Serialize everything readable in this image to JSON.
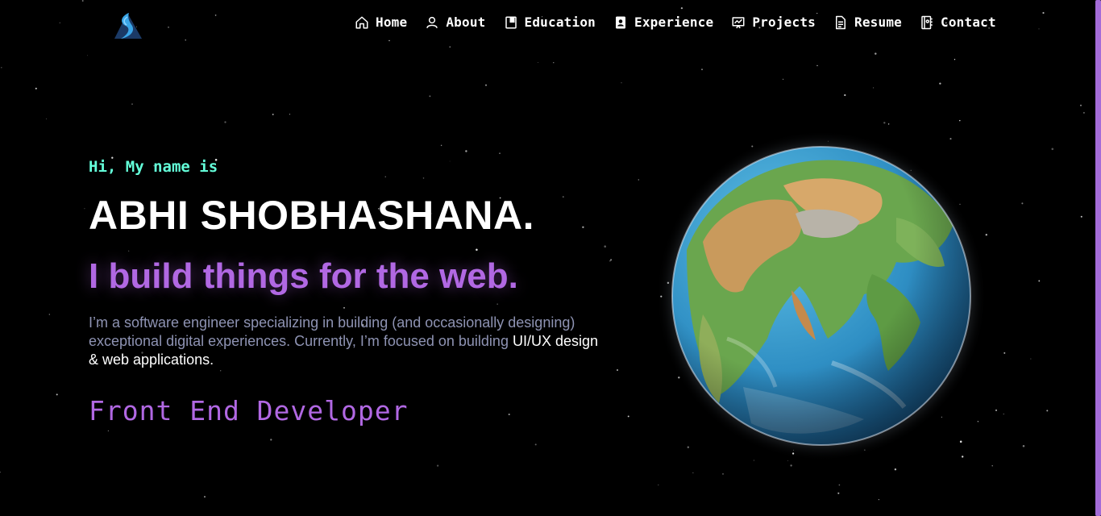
{
  "nav": {
    "items": [
      {
        "label": "Home",
        "icon": "home-icon"
      },
      {
        "label": "About",
        "icon": "user-icon"
      },
      {
        "label": "Education",
        "icon": "book-icon"
      },
      {
        "label": "Experience",
        "icon": "badge-icon"
      },
      {
        "label": "Projects",
        "icon": "presentation-icon"
      },
      {
        "label": "Resume",
        "icon": "document-icon"
      },
      {
        "label": "Contact",
        "icon": "contact-book-icon"
      }
    ]
  },
  "hero": {
    "greeting": "Hi, My name is",
    "name": "ABHI SHOBHASHANA.",
    "tagline": "I build things for the web.",
    "bio_text": "I’m a software engineer specializing in building (and occasionally designing) exceptional digital experiences. Currently, I’m focused on building ",
    "bio_highlight": "UI/UX design & web applications.",
    "role": "Front End Developer"
  },
  "colors": {
    "background": "#000000",
    "greeting": "#64ffda",
    "accent": "#b168e3",
    "body_text": "#8e93b3",
    "scrollbar": "#a46cd8"
  }
}
